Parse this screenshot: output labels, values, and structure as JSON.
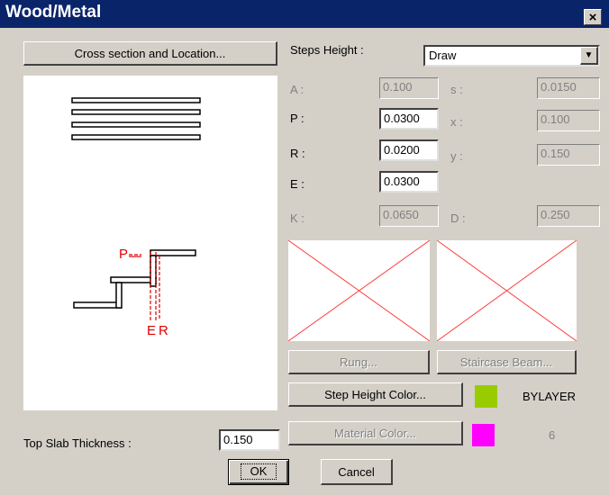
{
  "window": {
    "title": "Wood/Metal",
    "close_label": "×"
  },
  "buttons": {
    "cross_section": "Cross section and Location...",
    "rung": "Rung...",
    "staircase_beam": "Staircase Beam...",
    "step_height_color": "Step Height Color...",
    "material_color": "Material Color...",
    "ok": "OK",
    "cancel": "Cancel"
  },
  "steps_height": {
    "label": "Steps Height :",
    "value": "Draw"
  },
  "params": {
    "A": {
      "label": "A :",
      "value": "0.100"
    },
    "s": {
      "label": "s :",
      "value": "0.0150"
    },
    "P": {
      "label": "P :",
      "value": "0.0300"
    },
    "x": {
      "label": "x :",
      "value": "0.100"
    },
    "R": {
      "label": "R :",
      "value": "0.0200"
    },
    "y": {
      "label": "y :",
      "value": "0.150"
    },
    "E": {
      "label": "E :",
      "value": "0.0300"
    },
    "K": {
      "label": "K :",
      "value": "0.0650"
    },
    "D": {
      "label": "D :",
      "value": "0.250"
    }
  },
  "colors": {
    "step_height_swatch": "#99cc00",
    "step_height_text": "BYLAYER",
    "material_swatch": "#ff00ff",
    "material_text": "6"
  },
  "diagram": {
    "label_p": "P",
    "label_e": "E",
    "label_r": "R"
  },
  "top_slab": {
    "label": "Top Slab Thickness :",
    "value": "0.150"
  }
}
